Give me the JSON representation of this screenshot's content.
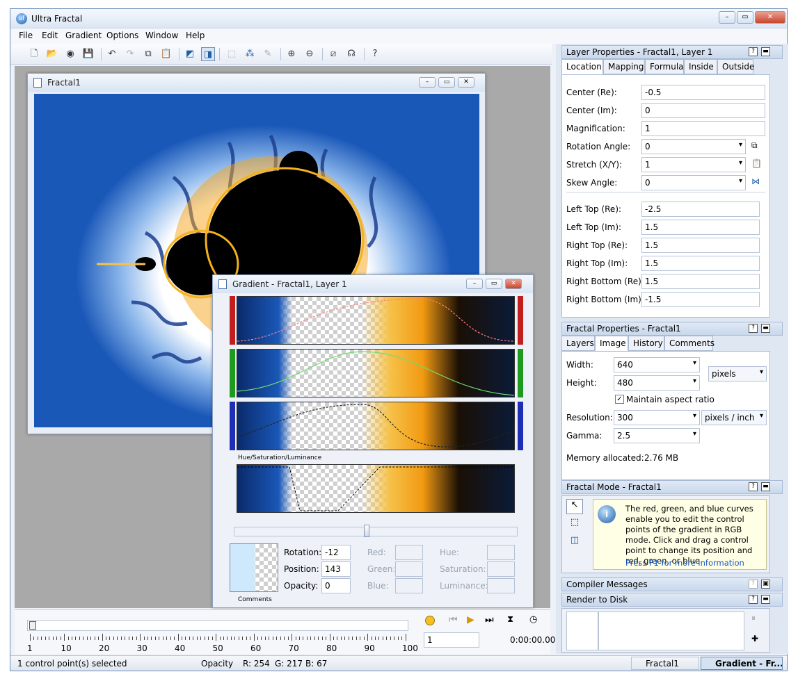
{
  "app": {
    "title": "Ultra Fractal"
  },
  "menu": [
    "File",
    "Edit",
    "Gradient",
    "Options",
    "Window",
    "Help"
  ],
  "toolbar": {
    "help_label": "?"
  },
  "fractal_window": {
    "title": "Fractal1"
  },
  "gradient_window": {
    "title": "Gradient - Fractal1, Layer 1",
    "hsl_label": "Hue/Saturation/Luminance",
    "comments_label": "Comments",
    "rotation_label": "Rotation:",
    "rotation_value": "-12",
    "position_label": "Position:",
    "position_value": "143",
    "opacity_label": "Opacity:",
    "opacity_value": "0",
    "red_label": "Red:",
    "green_label": "Green:",
    "blue_label": "Blue:",
    "hue_label": "Hue:",
    "saturation_label": "Saturation:",
    "luminance_label": "Luminance:"
  },
  "timeline": {
    "ticks": [
      "1",
      "10",
      "20",
      "30",
      "40",
      "50",
      "60",
      "70",
      "80",
      "90",
      "100"
    ],
    "frame_value": "1",
    "time": "0:00:00.00"
  },
  "layer_props": {
    "title": "Layer Properties - Fractal1, Layer 1",
    "tabs": [
      "Location",
      "Mapping",
      "Formula",
      "Inside",
      "Outside"
    ],
    "rows": [
      {
        "label": "Center (Re):",
        "value": "-0.5"
      },
      {
        "label": "Center (Im):",
        "value": "0"
      },
      {
        "label": "Magnification:",
        "value": "1"
      },
      {
        "label": "Rotation Angle:",
        "value": "0"
      },
      {
        "label": "Stretch (X/Y):",
        "value": "1"
      },
      {
        "label": "Skew Angle:",
        "value": "0"
      }
    ],
    "corners": [
      {
        "label": "Left Top (Re):",
        "value": "-2.5"
      },
      {
        "label": "Left Top (Im):",
        "value": "1.5"
      },
      {
        "label": "Right Top (Re):",
        "value": "1.5"
      },
      {
        "label": "Right Top (Im):",
        "value": "1.5"
      },
      {
        "label": "Right Bottom (Re):",
        "value": "1.5"
      },
      {
        "label": "Right Bottom (Im):",
        "value": "-1.5"
      }
    ]
  },
  "fractal_props": {
    "title": "Fractal Properties - Fractal1",
    "tabs": [
      "Layers",
      "Image",
      "History",
      "Comments"
    ],
    "width_label": "Width:",
    "width_value": "640",
    "height_label": "Height:",
    "height_value": "480",
    "units": "pixels",
    "maintain_label": "Maintain aspect ratio",
    "resolution_label": "Resolution:",
    "resolution_value": "300",
    "res_units": "pixels / inch",
    "gamma_label": "Gamma:",
    "gamma_value": "2.5",
    "memory_label": "Memory allocated:",
    "memory_value": "2.76 MB"
  },
  "fractal_mode": {
    "title": "Fractal Mode - Fractal1",
    "info": "The red, green, and blue curves enable you to edit the control points of the gradient in RGB mode. Click and drag a control point to change its position and red, green, or blue",
    "link": "Press F1 for more information"
  },
  "compiler": {
    "title": "Compiler Messages"
  },
  "render": {
    "title": "Render to Disk"
  },
  "status": {
    "selection": "1 control point(s) selected",
    "opacity": "Opacity",
    "r": "R: 254",
    "g": "G: 217",
    "b": "B: 67",
    "task1": "Fractal1",
    "task2": "Gradient - Fr..."
  }
}
